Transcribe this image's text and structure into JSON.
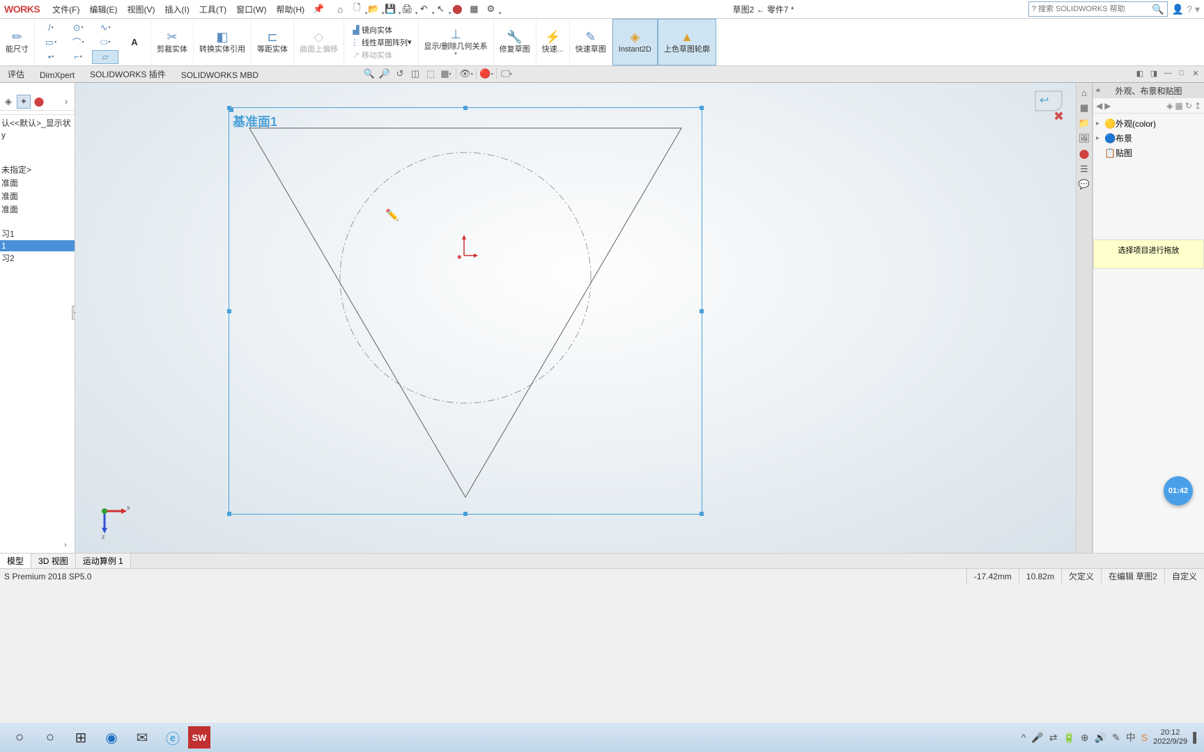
{
  "brand": "WORKS",
  "menu": [
    "文件(F)",
    "编辑(E)",
    "视图(V)",
    "插入(I)",
    "工具(T)",
    "窗口(W)",
    "帮助(H)"
  ],
  "doc_prefix": "草图2 ← 零件7",
  "asterisk": "*",
  "search_placeholder": "搜索 SOLIDWORKS 帮助",
  "ribbon": {
    "smart_dim": "能尺寸",
    "trim": "剪裁实体",
    "convert": "转换实体引用",
    "offset": "等距实体",
    "surface_offset": "曲面上偏移",
    "mirror": "镜向实体",
    "pattern": "线性草图阵列",
    "move": "移动实体",
    "show_rel": "显示/删除几何关系",
    "repair": "修复草图",
    "quick": "快速...",
    "rapid": "快速草图",
    "instant2d": "Instant2D",
    "shaded": "上色草图轮廓"
  },
  "tabs": [
    "评估",
    "DimXpert",
    "SOLIDWORKS 插件",
    "SOLIDWORKS MBD"
  ],
  "tree_items": [
    "认<<默认>_显示状",
    "y",
    "",
    "未指定>",
    "准面",
    "准面",
    "准面",
    "",
    "习1",
    "1",
    "习2"
  ],
  "plane": "基准面1",
  "right_title": "外观、布景和贴图",
  "right_tree": [
    {
      "ic": "🟡",
      "label": "外观(color)",
      "arr": "▸"
    },
    {
      "ic": "🔵",
      "label": "布景",
      "arr": "▸"
    },
    {
      "ic": "📋",
      "label": "贴图",
      "arr": ""
    }
  ],
  "hint": "选择项目进行拖放",
  "timer": "01:42",
  "bottom_tabs": [
    "模型",
    "3D 视图",
    "运动算例 1"
  ],
  "status": {
    "version": "S Premium 2018 SP5.0",
    "coord_x": "-17.42mm",
    "coord_y": "10.82m",
    "under": "欠定义",
    "editing": "在编辑 草图2",
    "custom": "自定义"
  },
  "clock": {
    "time": "20:12",
    "date": "2022/9/29"
  }
}
